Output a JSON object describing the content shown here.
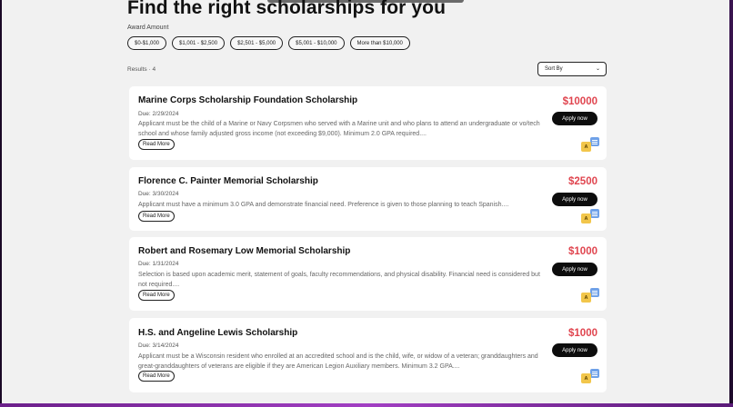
{
  "page_title": "Find the right scholarships for you",
  "award_amount_label": "Award Amount",
  "amount_filters": [
    "$0-$1,000",
    "$1,001 - $2,500",
    "$2,501 - $5,000",
    "$5,001 - $10,000",
    "More than $10,000"
  ],
  "results_label": "Results · 4",
  "sort_label": "Sort By",
  "scholarships": [
    {
      "title": "Marine Corps Scholarship Foundation Scholarship",
      "due": "Due: 2/29/2024",
      "description": "Applicant must be the child of a Marine or Navy Corpsmen who served with a Marine unit and who plans to attend an undergraduate or vo/tech school and whose family adjusted gross income (not exceeding $9,000). Minimum 2.0 GPA required....",
      "amount": "$10000",
      "read_more": "Read More",
      "apply": "Apply now"
    },
    {
      "title": "Florence C. Painter Memorial Scholarship",
      "due": "Due: 3/30/2024",
      "description": "Applicant must have a minimum 3.0 GPA and demonstrate financial need. Preference is given to those planning to teach Spanish....",
      "amount": "$2500",
      "read_more": "Read More",
      "apply": "Apply now"
    },
    {
      "title": "Robert and Rosemary Low Memorial Scholarship",
      "due": "Due: 1/31/2024",
      "description": "Selection is based upon academic merit, statement of goals, faculty recommendations, and physical disability. Financial need is considered but not required....",
      "amount": "$1000",
      "read_more": "Read More",
      "apply": "Apply now"
    },
    {
      "title": "H.S. and Angeline Lewis Scholarship",
      "due": "Due: 3/14/2024",
      "description": "Applicant must be a Wisconsin resident who enrolled at an accredited school and is the child, wife, or widow of a veteran; granddaughters and great-granddaughters of veterans are eligible if they are American Legion Auxiliary members. Minimum 3.2 GPA....",
      "amount": "$1000",
      "read_more": "Read More",
      "apply": "Apply now"
    }
  ],
  "translate_icon_text": "A",
  "colors": {
    "amount": "#e0454f",
    "apply_bg": "#0d0d0d",
    "page_bg": "#f1f1f1",
    "outer_bg": "#2a0f38"
  }
}
